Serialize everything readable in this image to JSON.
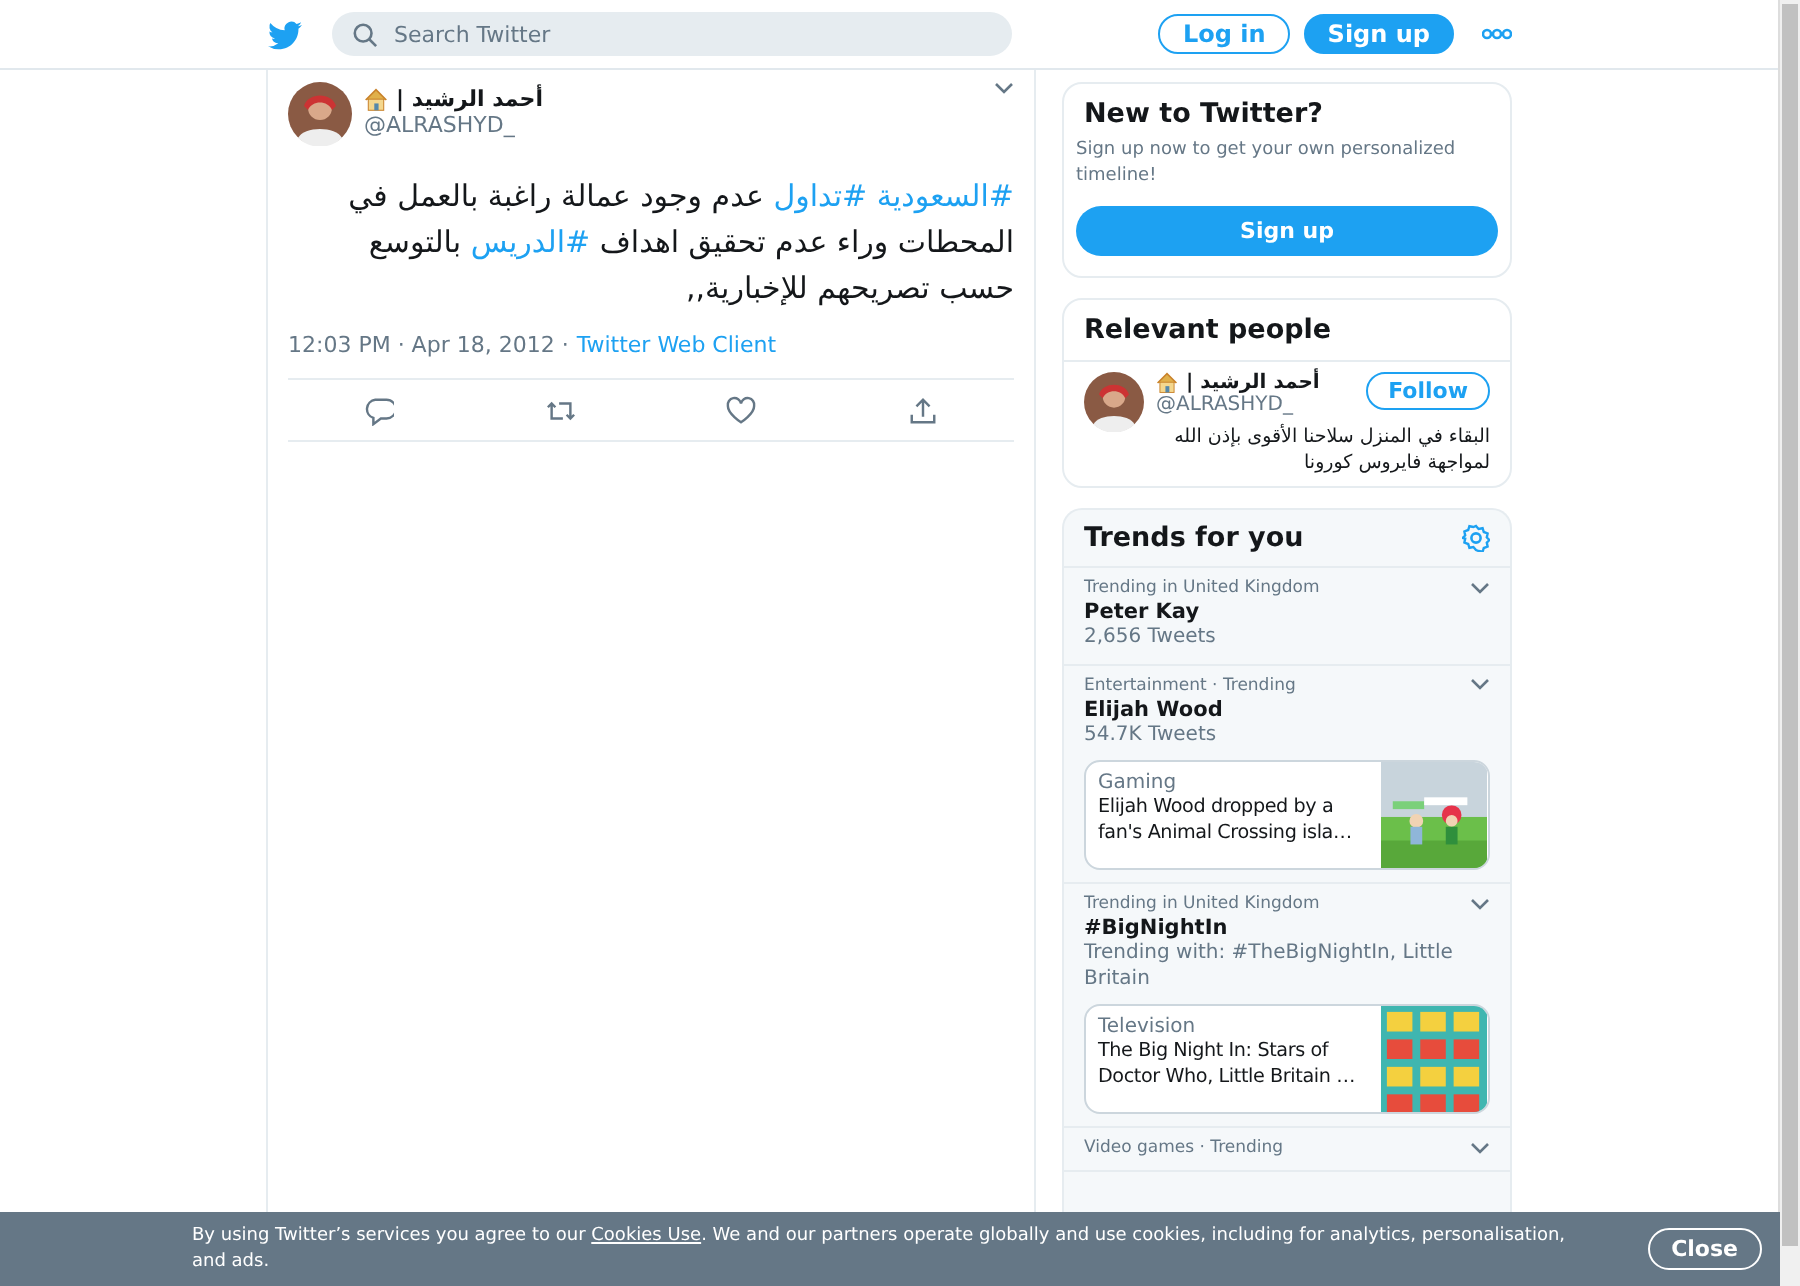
{
  "header": {
    "search_placeholder": "Search Twitter",
    "login": "Log in",
    "signup": "Sign up"
  },
  "tweet": {
    "name": "أحمد الرشيد |",
    "handle": "@ALRASHYD_",
    "segments": [
      {
        "kind": "hashtag",
        "text": "#السعودية"
      },
      {
        "kind": "hashtag",
        "text": "#تداول"
      },
      {
        "kind": "text",
        "text": "عدم وجود عمالة راغبة بالعمل في المحطات وراء عدم تحقيق اهداف"
      },
      {
        "kind": "hashtag",
        "text": "#الدريس"
      },
      {
        "kind": "text",
        "text": "بالتوسع حسب تصريحهم للإخبارية,,"
      }
    ],
    "meta": "12:03 PM · Apr 18, 2012 ·",
    "source": "Twitter Web Client"
  },
  "new_to_twitter": {
    "title": "New to Twitter?",
    "text": "Sign up now to get your own personalized timeline!",
    "button": "Sign up"
  },
  "relevant_people": {
    "title": "Relevant people",
    "people": [
      {
        "name": "أحمد الرشيد |",
        "handle": "@ALRASHYD_",
        "bio": "البقاء في المنزل سلاحنا الأقوى بإذن الله لمواجهة فايروس كورونا",
        "follow": "Follow"
      }
    ]
  },
  "trends": {
    "title": "Trends for you",
    "items": [
      {
        "context": "Trending in United Kingdom",
        "name": "Peter Kay",
        "count": "2,656 Tweets"
      },
      {
        "context": "Entertainment · Trending",
        "name": "Elijah Wood",
        "count": "54.7K Tweets",
        "card": {
          "category": "Gaming",
          "title": "Elijah Wood dropped by a fan's Animal Crossing isla…"
        }
      },
      {
        "context": "Trending in United Kingdom",
        "name": "#BigNightIn",
        "count": "Trending with: #TheBigNightIn, Little Britain",
        "card": {
          "category": "Television",
          "title": "The Big Night In: Stars of Doctor Who, Little Britain …"
        }
      },
      {
        "context": "Video games · Trending"
      }
    ]
  },
  "cookie_banner": {
    "text_before": "By using Twitter’s services you agree to our ",
    "link": "Cookies Use",
    "text_after": ". We and our partners operate globally and use cookies, including for analytics, personalisation, and ads.",
    "close": "Close"
  }
}
